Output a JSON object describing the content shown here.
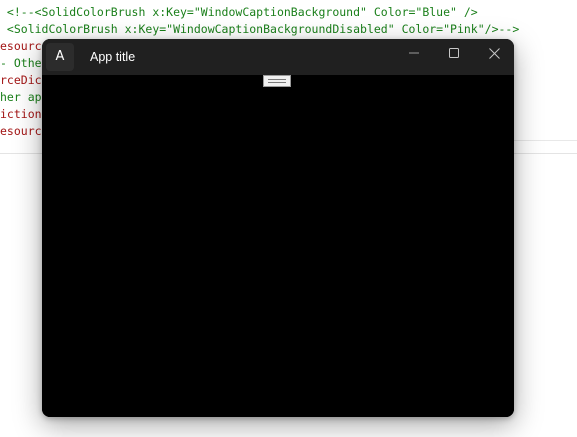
{
  "editor": {
    "lines": [
      {
        "text": " <!--<SolidColorBrush x:Key=\"WindowCaptionBackground\" Color=\"Blue\" />",
        "color": "green"
      },
      {
        "text": " <SolidColorBrush x:Key=\"WindowCaptionBackgroundDisabled\" Color=\"Pink\"/>-->",
        "color": "green"
      },
      {
        "text": "esourc",
        "color": "red"
      },
      {
        "text": "- Othe",
        "color": "green"
      },
      {
        "text": "rceDic",
        "color": "red"
      },
      {
        "text": "her ap",
        "color": "green"
      },
      {
        "text": "iction",
        "color": "red"
      },
      {
        "text": "esourc",
        "color": "red"
      }
    ]
  },
  "window": {
    "icon_letter": "A",
    "title": "App title",
    "buttons": {
      "minimize": "minimize-icon",
      "maximize": "maximize-icon",
      "close": "close-icon"
    },
    "colors": {
      "titlebar": "#202020",
      "client": "#000000",
      "text": "#ffffff"
    }
  }
}
